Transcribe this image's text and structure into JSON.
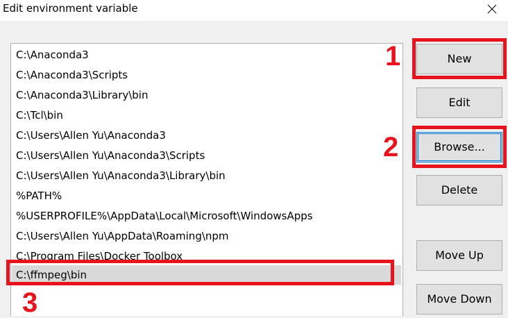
{
  "window": {
    "title": "Edit environment variable",
    "close_icon": "close-icon"
  },
  "list": {
    "items": [
      "C:\\Anaconda3",
      "C:\\Anaconda3\\Scripts",
      "C:\\Anaconda3\\Library\\bin",
      "C:\\Tcl\\bin",
      "C:\\Users\\Allen Yu\\Anaconda3",
      "C:\\Users\\Allen Yu\\Anaconda3\\Scripts",
      "C:\\Users\\Allen Yu\\Anaconda3\\Library\\bin",
      "%PATH%",
      "%USERPROFILE%\\AppData\\Local\\Microsoft\\WindowsApps",
      "C:\\Users\\Allen Yu\\AppData\\Roaming\\npm",
      "C:\\Program Files\\Docker Toolbox",
      "C:\\ffmpeg\\bin"
    ],
    "selected_item": "C:\\ffmpeg\\bin"
  },
  "buttons": {
    "new": "New",
    "edit": "Edit",
    "browse": "Browse...",
    "delete": "Delete",
    "move_up": "Move Up",
    "move_down": "Move Down"
  },
  "annotations": {
    "marker_1": "1",
    "marker_2": "2",
    "marker_3": "3",
    "highlight_color": "#e8141d"
  }
}
